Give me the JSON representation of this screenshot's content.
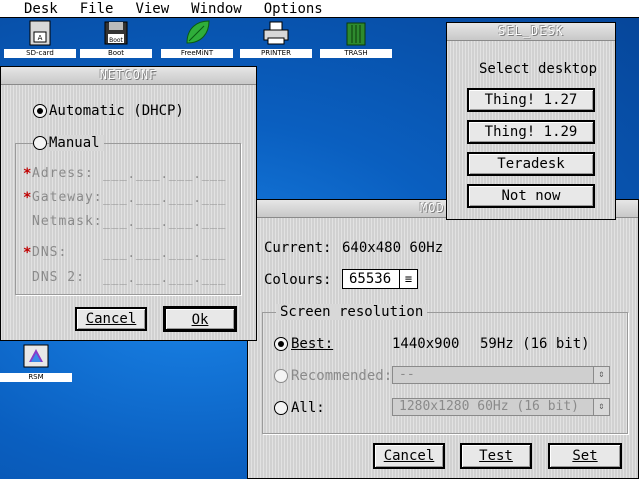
{
  "menubar": {
    "items": [
      "Desk",
      "File",
      "View",
      "Window",
      "Options"
    ]
  },
  "desktop_icons": [
    {
      "label": "SD-card",
      "icon": "sd-card-icon"
    },
    {
      "label": "Boot",
      "icon": "boot-disk-icon"
    },
    {
      "label": "FreeMiNT",
      "icon": "leaf-icon"
    },
    {
      "label": "PRINTER",
      "icon": "printer-icon"
    },
    {
      "label": "TRASH",
      "icon": "trash-icon"
    },
    {
      "label": "RSM",
      "icon": "rsm-icon"
    }
  ],
  "netconf": {
    "title": "NETCONF",
    "automatic_label": "Automatic (DHCP)",
    "manual_label": "Manual",
    "fields": [
      {
        "label": "Adress:",
        "value": "___.___.___.___",
        "required": "*"
      },
      {
        "label": "Gateway:",
        "value": "___.___.___.___",
        "required": "*"
      },
      {
        "label": "Netmask:",
        "value": "___.___.___.___",
        "required": ""
      },
      {
        "label": "DNS:",
        "value": "___.___.___.___",
        "required": "*"
      },
      {
        "label": "DNS 2:",
        "value": "___.___.___.___",
        "required": ""
      }
    ],
    "cancel_label": "Cancel",
    "ok_label": "Ok"
  },
  "sel_desk": {
    "title": "SEL_DESK",
    "heading": "Select desktop",
    "options": [
      "Thing! 1.27",
      "Thing! 1.29",
      "Teradesk",
      "Not now"
    ]
  },
  "mode": {
    "title_visible": "MOD",
    "current_label": "Current:",
    "current_value": "640x480 60Hz",
    "colours_label": "Colours:",
    "colours_value": "65536",
    "colours_arrow": "≡",
    "resolution_title": "Screen resolution",
    "best_label": "Best:",
    "best_resolution": "1440x900",
    "best_rate": "59Hz (16 bit)",
    "recommended_label": "Recommended:",
    "recommended_value": "--",
    "all_label": "All:",
    "all_value": "1280x1280  60Hz (16 bit)",
    "popup_arrow": "⇕",
    "cancel_label": "Cancel",
    "test_label": "Test",
    "set_label": "Set"
  },
  "colors": {
    "desktop": "#0a64c8",
    "window": "#dcdcdc",
    "required": "#c00000"
  }
}
